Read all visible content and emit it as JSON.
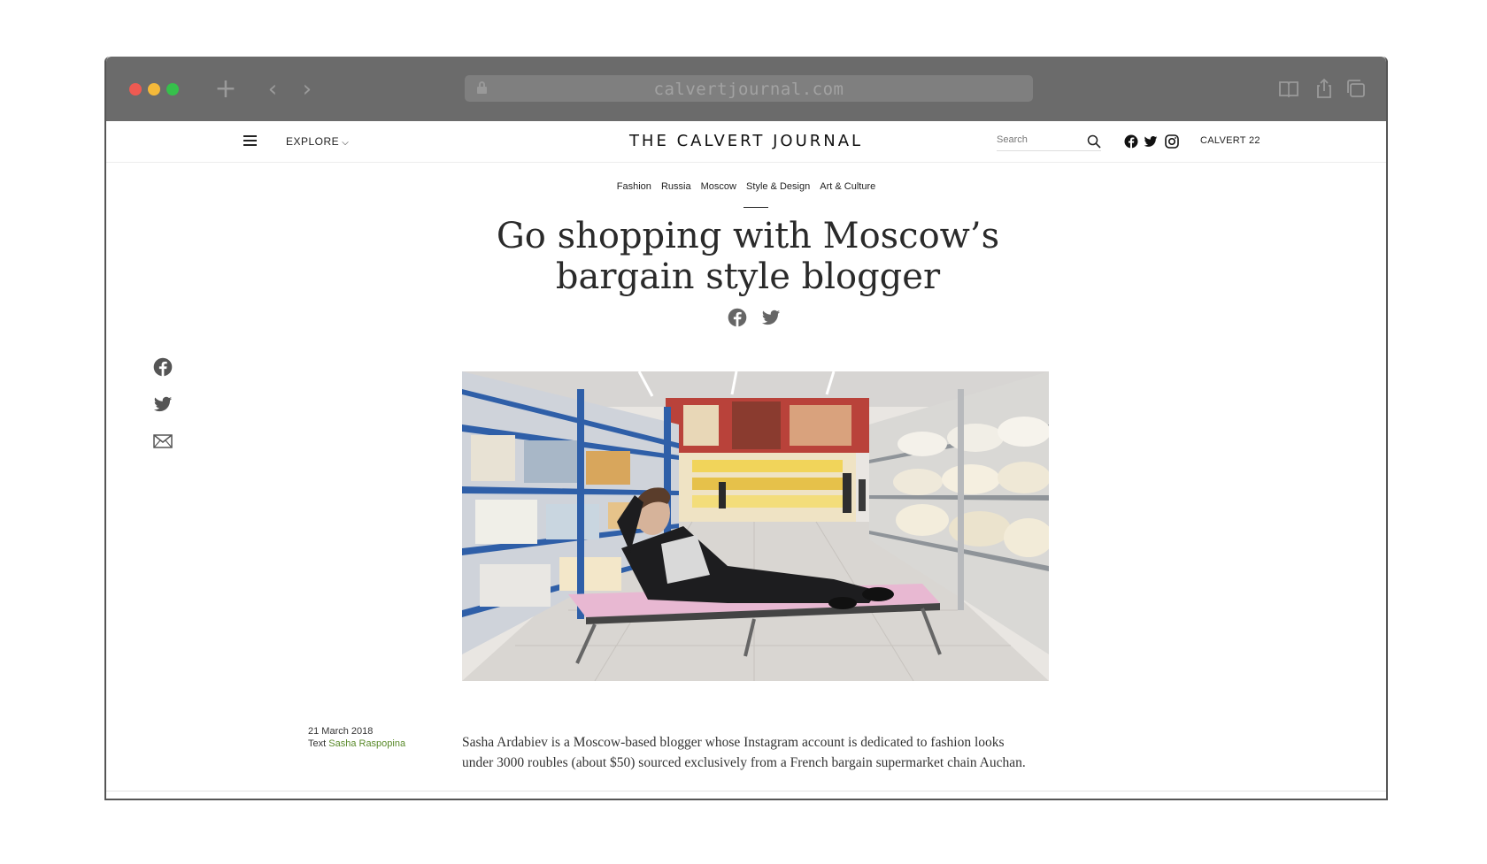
{
  "browser": {
    "url": "calvertjournal.com",
    "new_tab_glyph": "+",
    "back_glyph": "‹",
    "forward_glyph": "›"
  },
  "nav": {
    "explore_label": "EXPLORE",
    "explore_chevron": "⌵",
    "logo": "THE CALVERT  JOURNAL",
    "search_placeholder": "Search",
    "calvert22_label": "CALVERT 22"
  },
  "article": {
    "tags": [
      "Fashion",
      "Russia",
      "Moscow",
      "Style & Design",
      "Art & Culture"
    ],
    "headline_line1": "Go shopping with Moscow’s",
    "headline_line2": "bargain style blogger",
    "date": "21 March 2018",
    "text_label": "Text",
    "author": "Sasha Raspopina",
    "body": "Sasha Ardabiev is a Moscow-based blogger whose Instagram account is dedicated to fashion looks under 3000 roubles (about $50) sourced exclusively from a French bargain supermarket chain Auchan."
  },
  "colors": {
    "titlebar": "#6b6b6b",
    "author_link": "#5a8a2a",
    "shelf_blue": "#2f5fa8"
  },
  "icons": [
    "lock-icon",
    "reader-icon",
    "share-icon",
    "tabs-icon",
    "hamburger-icon",
    "search-icon",
    "facebook-icon",
    "twitter-icon",
    "instagram-icon",
    "mail-icon"
  ]
}
